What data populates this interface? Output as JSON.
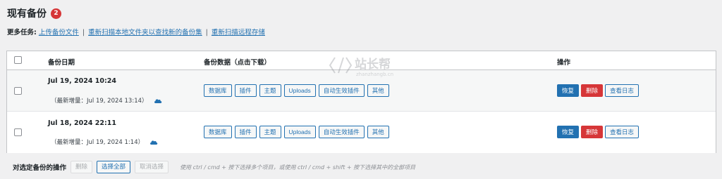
{
  "header": {
    "title": "现有备份",
    "count": "2"
  },
  "more_tasks": {
    "label": "更多任务:",
    "links": [
      "上传备份文件",
      "重新扫描本地文件夹以查找新的备份集",
      "重新扫描远程存储"
    ]
  },
  "table": {
    "columns": {
      "date": "备份日期",
      "data": "备份数据（点击下载）",
      "actions": "操作"
    },
    "rows": [
      {
        "date": "Jul 19, 2024 10:24",
        "incremental": "（最新增量：Jul 19, 2024 13:14）",
        "data_buttons": [
          "数据库",
          "插件",
          "主题",
          "Uploads",
          "自动生效插件",
          "其他"
        ],
        "actions": {
          "restore": "恢复",
          "delete": "删除",
          "log": "查看日志"
        }
      },
      {
        "date": "Jul 18, 2024 22:11",
        "incremental": "（最新增量：Jul 19, 2024 1:14）",
        "data_buttons": [
          "数据库",
          "插件",
          "主题",
          "Uploads",
          "自动生效插件",
          "其他"
        ],
        "actions": {
          "restore": "恢复",
          "delete": "删除",
          "log": "查看日志"
        }
      }
    ]
  },
  "bulk": {
    "label": "对选定备份的操作",
    "delete": "删除",
    "select_all": "选择全部",
    "deselect": "取消选择",
    "hint": "使用 ctrl / cmd + 按下选择多个项目，或使用 ctrl / cmd + shift + 按下选择其中的全部项目"
  },
  "watermark": {
    "text": "站长帮",
    "subtext": "zhanzhangb.cn"
  },
  "colors": {
    "primary": "#2271b1",
    "danger": "#d63638",
    "background": "#f0f0f1"
  },
  "icons": {
    "cloud": "cloud-icon",
    "watermark": "code-brackets-icon"
  }
}
